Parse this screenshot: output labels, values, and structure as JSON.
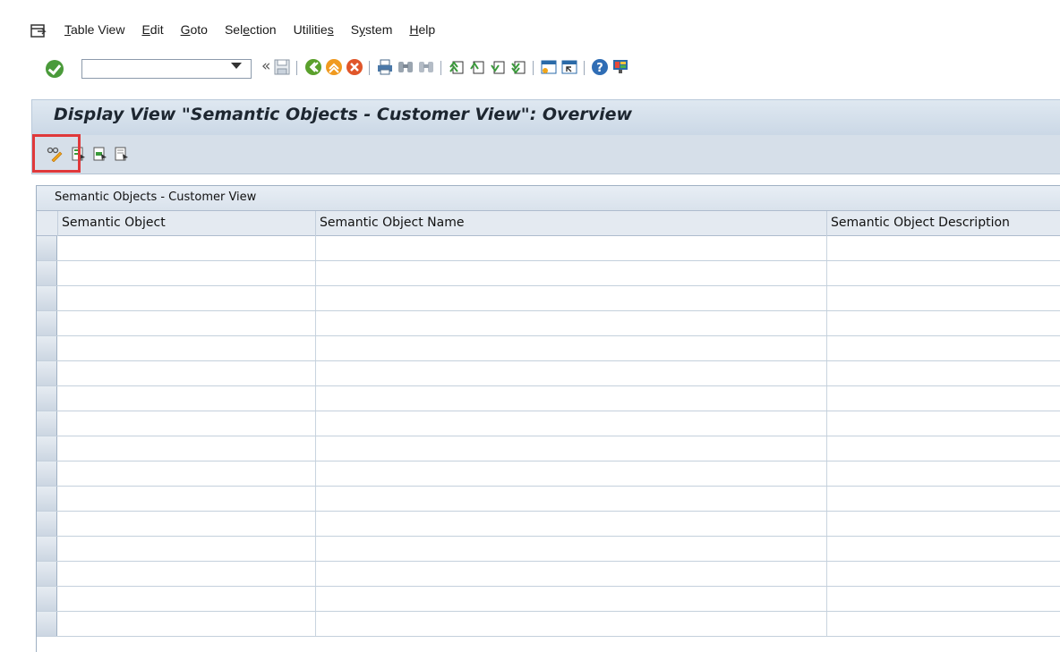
{
  "menu": {
    "items": [
      {
        "pre": "",
        "u": "T",
        "post": "able View"
      },
      {
        "pre": "",
        "u": "E",
        "post": "dit"
      },
      {
        "pre": "",
        "u": "G",
        "post": "oto"
      },
      {
        "pre": "Sel",
        "u": "e",
        "post": "ction"
      },
      {
        "pre": "Utilitie",
        "u": "s",
        "post": ""
      },
      {
        "pre": "S",
        "u": "y",
        "post": "stem"
      },
      {
        "pre": "",
        "u": "H",
        "post": "elp"
      }
    ]
  },
  "toolbar": {
    "command_field_value": "",
    "chevron": "«",
    "icons": [
      "enter-icon",
      "save-icon",
      "back-icon",
      "exit-icon",
      "cancel-icon",
      "print-icon",
      "find-icon",
      "find-next-icon",
      "first-page-icon",
      "previous-page-icon",
      "next-page-icon",
      "last-page-icon",
      "create-session-icon",
      "shortcut-icon",
      "help-icon",
      "customize-layout-icon"
    ]
  },
  "screen": {
    "title": "Display View \"Semantic Objects - Customer View\": Overview",
    "app_icons": [
      "display-change-icon",
      "select-all-icon",
      "select-block-icon",
      "deselect-all-icon"
    ]
  },
  "table": {
    "caption": "Semantic Objects - Customer View",
    "columns": [
      "Semantic Object",
      "Semantic Object Name",
      "Semantic Object Description"
    ],
    "rows": [
      [
        "",
        "",
        ""
      ],
      [
        "",
        "",
        ""
      ],
      [
        "",
        "",
        ""
      ],
      [
        "",
        "",
        ""
      ],
      [
        "",
        "",
        ""
      ],
      [
        "",
        "",
        ""
      ],
      [
        "",
        "",
        ""
      ],
      [
        "",
        "",
        ""
      ],
      [
        "",
        "",
        ""
      ],
      [
        "",
        "",
        ""
      ],
      [
        "",
        "",
        ""
      ],
      [
        "",
        "",
        ""
      ],
      [
        "",
        "",
        ""
      ],
      [
        "",
        "",
        ""
      ],
      [
        "",
        "",
        ""
      ],
      [
        "",
        "",
        ""
      ]
    ]
  },
  "colors": {
    "highlight": "#e0383a",
    "ok_green": "#4a9a3a",
    "panel_blue": "#d6dfe9"
  }
}
